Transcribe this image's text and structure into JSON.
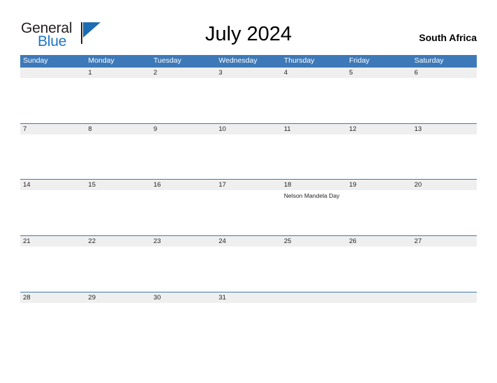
{
  "brand": {
    "name_part1": "General",
    "name_part2": "Blue",
    "flag_icon": "triangle-flag-icon",
    "primary_color": "#1b6cb3",
    "text_color": "#231f20"
  },
  "header": {
    "title": "July 2024",
    "country": "South Africa"
  },
  "calendar": {
    "header_color": "#3d79b8",
    "daynum_band_color": "#efefef",
    "day_names": [
      "Sunday",
      "Monday",
      "Tuesday",
      "Wednesday",
      "Thursday",
      "Friday",
      "Saturday"
    ],
    "weeks": [
      {
        "days": [
          {
            "num": "",
            "event": ""
          },
          {
            "num": "1",
            "event": ""
          },
          {
            "num": "2",
            "event": ""
          },
          {
            "num": "3",
            "event": ""
          },
          {
            "num": "4",
            "event": ""
          },
          {
            "num": "5",
            "event": ""
          },
          {
            "num": "6",
            "event": ""
          }
        ]
      },
      {
        "days": [
          {
            "num": "7",
            "event": ""
          },
          {
            "num": "8",
            "event": ""
          },
          {
            "num": "9",
            "event": ""
          },
          {
            "num": "10",
            "event": ""
          },
          {
            "num": "11",
            "event": ""
          },
          {
            "num": "12",
            "event": ""
          },
          {
            "num": "13",
            "event": ""
          }
        ]
      },
      {
        "days": [
          {
            "num": "14",
            "event": ""
          },
          {
            "num": "15",
            "event": ""
          },
          {
            "num": "16",
            "event": ""
          },
          {
            "num": "17",
            "event": ""
          },
          {
            "num": "18",
            "event": "Nelson Mandela Day"
          },
          {
            "num": "19",
            "event": ""
          },
          {
            "num": "20",
            "event": ""
          }
        ]
      },
      {
        "days": [
          {
            "num": "21",
            "event": ""
          },
          {
            "num": "22",
            "event": ""
          },
          {
            "num": "23",
            "event": ""
          },
          {
            "num": "24",
            "event": ""
          },
          {
            "num": "25",
            "event": ""
          },
          {
            "num": "26",
            "event": ""
          },
          {
            "num": "27",
            "event": ""
          }
        ]
      },
      {
        "days": [
          {
            "num": "28",
            "event": ""
          },
          {
            "num": "29",
            "event": ""
          },
          {
            "num": "30",
            "event": ""
          },
          {
            "num": "31",
            "event": ""
          },
          {
            "num": "",
            "event": ""
          },
          {
            "num": "",
            "event": ""
          },
          {
            "num": "",
            "event": ""
          }
        ]
      }
    ]
  }
}
